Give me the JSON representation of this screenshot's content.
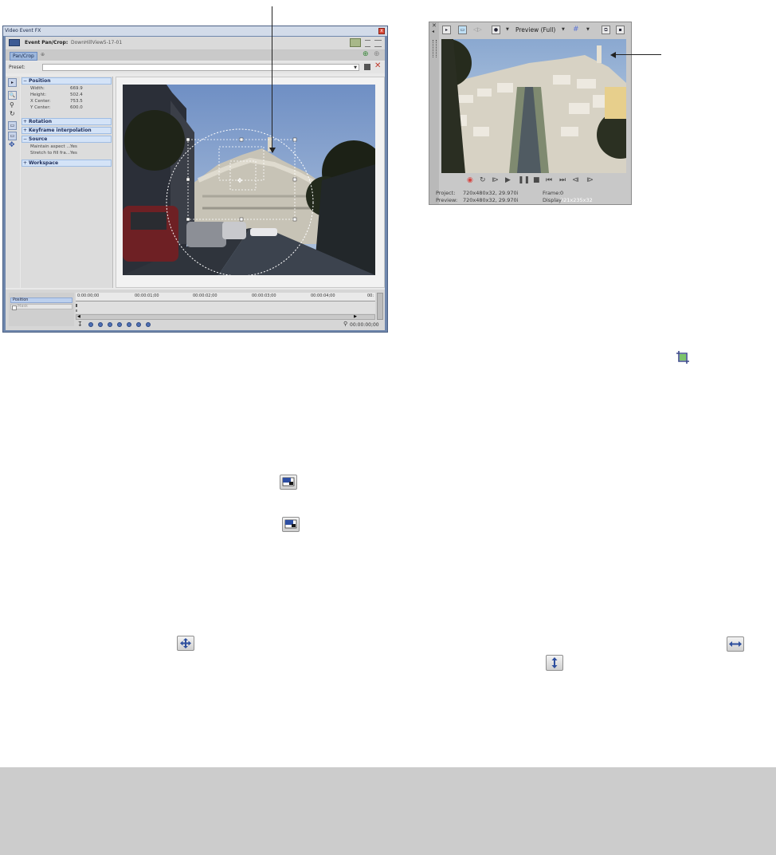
{
  "vefx": {
    "title": "Video Event FX",
    "event_label": "Event Pan/Crop:",
    "event_name": "DownHillView5-17-01",
    "tab": "Pan/Crop",
    "preset_label": "Preset:",
    "sections": {
      "position": "Position",
      "rotation": "Rotation",
      "keyframe": "Keyframe interpolation",
      "source": "Source",
      "workspace": "Workspace"
    },
    "position_props": [
      {
        "name": "Width:",
        "value": "669.9"
      },
      {
        "name": "Height:",
        "value": "502.4"
      },
      {
        "name": "X Center:",
        "value": "753.5"
      },
      {
        "name": "Y Center:",
        "value": "600.0"
      }
    ],
    "source_props": [
      {
        "name": "Maintain aspect ...",
        "value": "Yes"
      },
      {
        "name": "Stretch to fill fra...",
        "value": "Yes"
      }
    ],
    "timeline": {
      "track_position": "Position",
      "track_mask": "Mask",
      "ticks": [
        "0:00:00;00",
        "00:00:01;00",
        "00:00:02;00",
        "00:00:03;00",
        "00:00:04;00",
        "00:"
      ],
      "time": "00:00:00;00"
    }
  },
  "preview": {
    "mode": "Preview (Full)",
    "project_label": "Project:",
    "project_value": "720x480x32, 29.970i",
    "frame_label": "Frame:",
    "frame_value": "0",
    "preview_label": "Preview:",
    "preview_value": "720x480x32, 29.970i",
    "display_label": "Display:",
    "display_value": "321x235x32"
  },
  "icons": [
    "crop-icon",
    "workspace-fit-icon",
    "workspace-fit-icon-2",
    "move-icon",
    "horizontal-move-icon",
    "vertical-move-icon"
  ],
  "colors": {
    "window_frame": "#6f87ad",
    "selection": "#9db7dd",
    "footer": "#cccccc"
  }
}
